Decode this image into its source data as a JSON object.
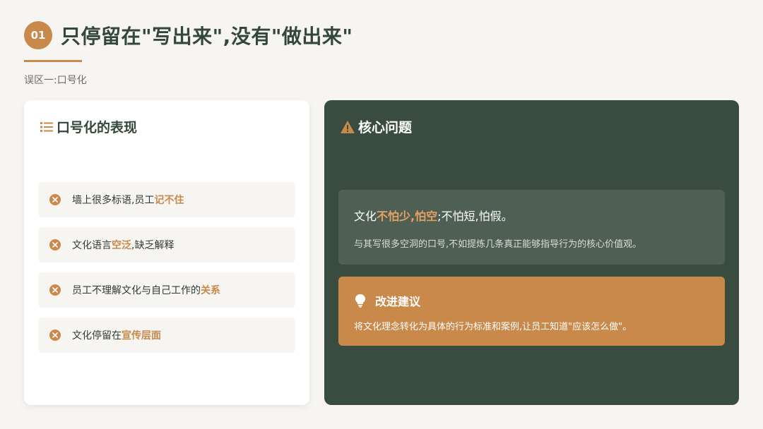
{
  "header": {
    "number": "01",
    "title": "只停留在\"写出来\",没有\"做出来\"",
    "subtitle": "误区一:口号化"
  },
  "left_panel": {
    "title": "口号化的表现",
    "icon": "list-icon",
    "items": [
      {
        "icon": "x-circle-icon",
        "text": "墙上很多标语,员工",
        "highlight": "记不住",
        "after": ""
      },
      {
        "icon": "x-circle-icon",
        "text": "文化语言",
        "highlight": "空泛",
        "after": ",缺乏解释"
      },
      {
        "icon": "x-circle-icon",
        "text": "员工不理解文化与自己工作的",
        "highlight": "关系",
        "after": ""
      },
      {
        "icon": "x-circle-icon",
        "text": "文化停留在",
        "highlight": "宣传层面",
        "after": ""
      }
    ]
  },
  "right_panel": {
    "title": "核心问题",
    "icon": "warning-icon",
    "core": {
      "prefix": "文化",
      "highlight": "不怕少,怕空",
      "suffix": ";不怕短,怕假。",
      "detail": "与其写很多空洞的口号,不如提炼几条真正能够指导行为的核心价值观。"
    },
    "tip": {
      "icon": "lightbulb-icon",
      "title": "改进建议",
      "text": "将文化理念转化为具体的行为标准和案例,让员工知道\"应该怎么做\"。"
    }
  },
  "colors": {
    "accent": "#c8894a",
    "dark_green": "#3a4c40",
    "background": "#f7f5f2"
  }
}
